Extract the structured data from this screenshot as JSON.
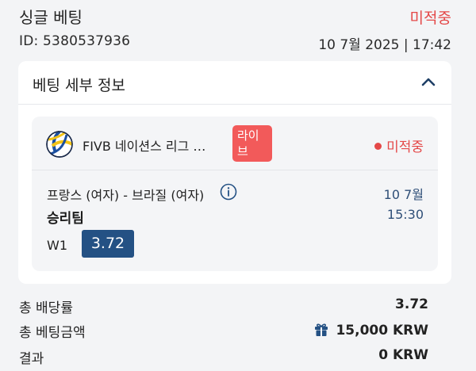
{
  "header": {
    "title": "싱글 베팅",
    "status": "미적중",
    "bet_id": "ID: 5380537936",
    "datetime": "10 7월 2025 | 17:42"
  },
  "details": {
    "title": "베팅 세부 정보",
    "league": "FIVB 네이션스 리그 …",
    "live_badge_line1": "라이",
    "live_badge_line2": "브",
    "status": "미적중",
    "match": "프랑스 (여자) - 브라질 (여자)",
    "match_date": "10 7월",
    "market": "승리팀",
    "match_time": "15:30",
    "selection": "W1",
    "odds": "3.72"
  },
  "summary": {
    "total_odds_label": "총 배당률",
    "total_odds_value": "3.72",
    "total_stake_label": "총 베팅금액",
    "total_stake_value": "15,000 KRW",
    "result_label": "결과",
    "result_value": "0 KRW"
  },
  "colors": {
    "status_red": "#e44848",
    "live_red": "#f25a5a",
    "odds_blue": "#245184",
    "date_blue": "#2f4f78"
  },
  "icons": [
    "chevron-up-icon",
    "volleyball-icon",
    "info-icon",
    "gift-icon"
  ]
}
